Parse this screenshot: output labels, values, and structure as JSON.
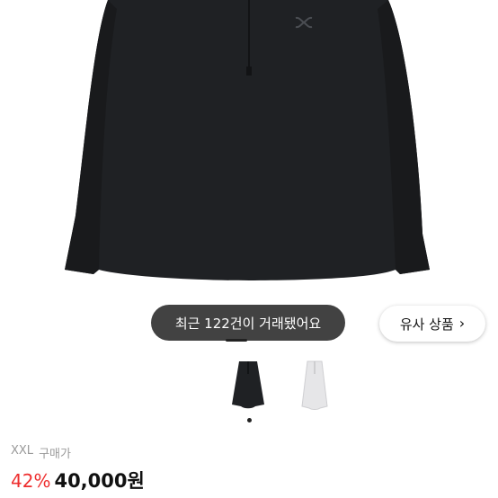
{
  "product": {
    "brand_icon": "under-armour-logo-icon",
    "trade_badge": "최근 122건이 거래됐어요",
    "similar_button": "유사 상품",
    "similar_chevron": "›",
    "thumbnails": [
      {
        "name": "black-shirt-thumbnail",
        "color": "#1f2124"
      },
      {
        "name": "white-shirt-thumbnail",
        "color": "#e6e6e8"
      }
    ],
    "size": "XXL",
    "purchase_label": "구매가",
    "discount": "42%",
    "price": "40,000원"
  },
  "colors": {
    "shirt": "#1f2124",
    "discount": "#ee2e2e",
    "badge_bg": "#282828"
  }
}
